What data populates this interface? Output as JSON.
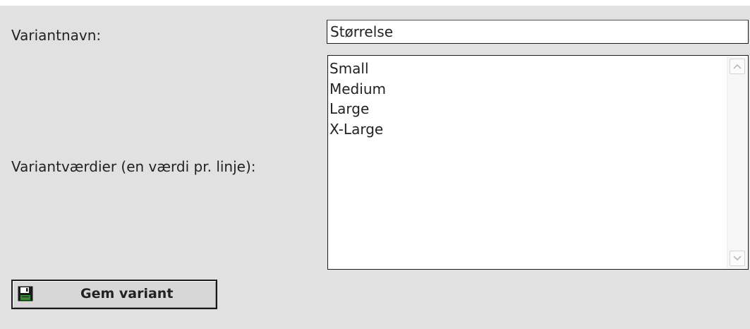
{
  "form": {
    "name_label": "Variantnavn:",
    "name_value": "Størrelse",
    "values_label": "Variantværdier (en værdi pr. linje):",
    "values": [
      "Small",
      "Medium",
      "Large",
      "X-Large"
    ],
    "save_label": "Gem variant",
    "save_icon": "floppy-disk-icon"
  },
  "colors": {
    "panel_bg": "#e1e1e1",
    "page_bg": "#ffffff",
    "border": "#1a1a1a",
    "text": "#222222"
  }
}
